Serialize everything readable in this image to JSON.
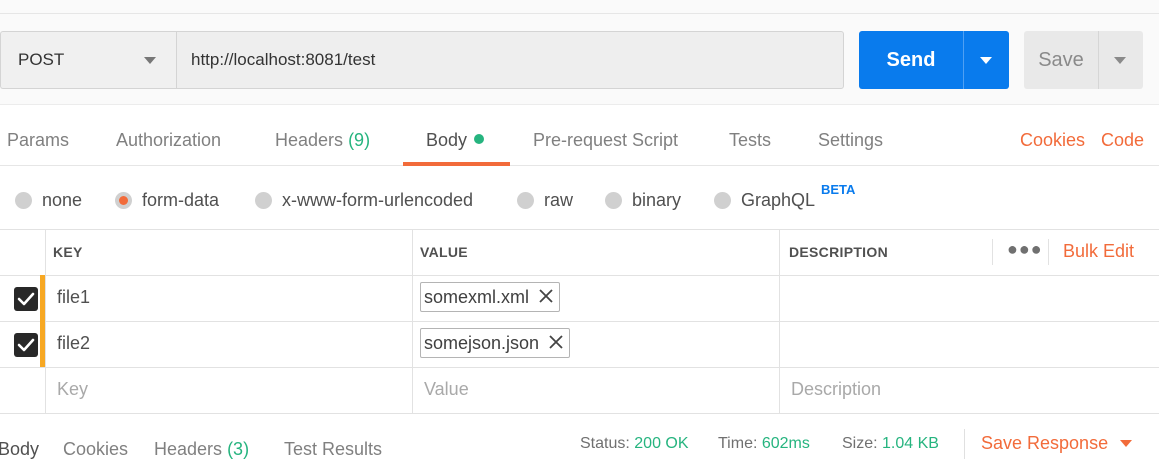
{
  "request": {
    "method": "POST",
    "url": "http://localhost:8081/test",
    "send_label": "Send",
    "save_label": "Save"
  },
  "tabs": [
    {
      "label": "Params"
    },
    {
      "label": "Authorization"
    },
    {
      "label": "Headers",
      "count": "(9)"
    },
    {
      "label": "Body",
      "active": true,
      "indicator": "green-dot"
    },
    {
      "label": "Pre-request Script"
    },
    {
      "label": "Tests"
    },
    {
      "label": "Settings"
    }
  ],
  "tab_links": {
    "cookies": "Cookies",
    "code": "Code"
  },
  "body_types": [
    {
      "label": "none"
    },
    {
      "label": "form-data",
      "selected": true
    },
    {
      "label": "x-www-form-urlencoded"
    },
    {
      "label": "raw"
    },
    {
      "label": "binary"
    },
    {
      "label": "GraphQL",
      "badge": "BETA"
    }
  ],
  "table": {
    "headers": {
      "key": "KEY",
      "value": "VALUE",
      "description": "DESCRIPTION"
    },
    "more_icon": "more-horizontal-icon",
    "bulk_edit": "Bulk Edit",
    "rows": [
      {
        "checked": true,
        "key": "file1",
        "value": "somexml.xml",
        "description": ""
      },
      {
        "checked": true,
        "key": "file2",
        "value": "somejson.json",
        "description": ""
      }
    ],
    "placeholders": {
      "key": "Key",
      "value": "Value",
      "description": "Description"
    }
  },
  "response": {
    "tabs": [
      {
        "label": "Body",
        "active": true
      },
      {
        "label": "Cookies"
      },
      {
        "label": "Headers",
        "count": "(3)"
      },
      {
        "label": "Test Results"
      }
    ],
    "status_label": "Status:",
    "status_value": "200 OK",
    "time_label": "Time:",
    "time_value": "602ms",
    "size_label": "Size:",
    "size_value": "1.04 KB",
    "save_response": "Save Response"
  },
  "colors": {
    "accent_orange": "#f26b3a",
    "send_blue": "#097bed",
    "success_green": "#26b47f",
    "row_marker": "#f7a823"
  }
}
